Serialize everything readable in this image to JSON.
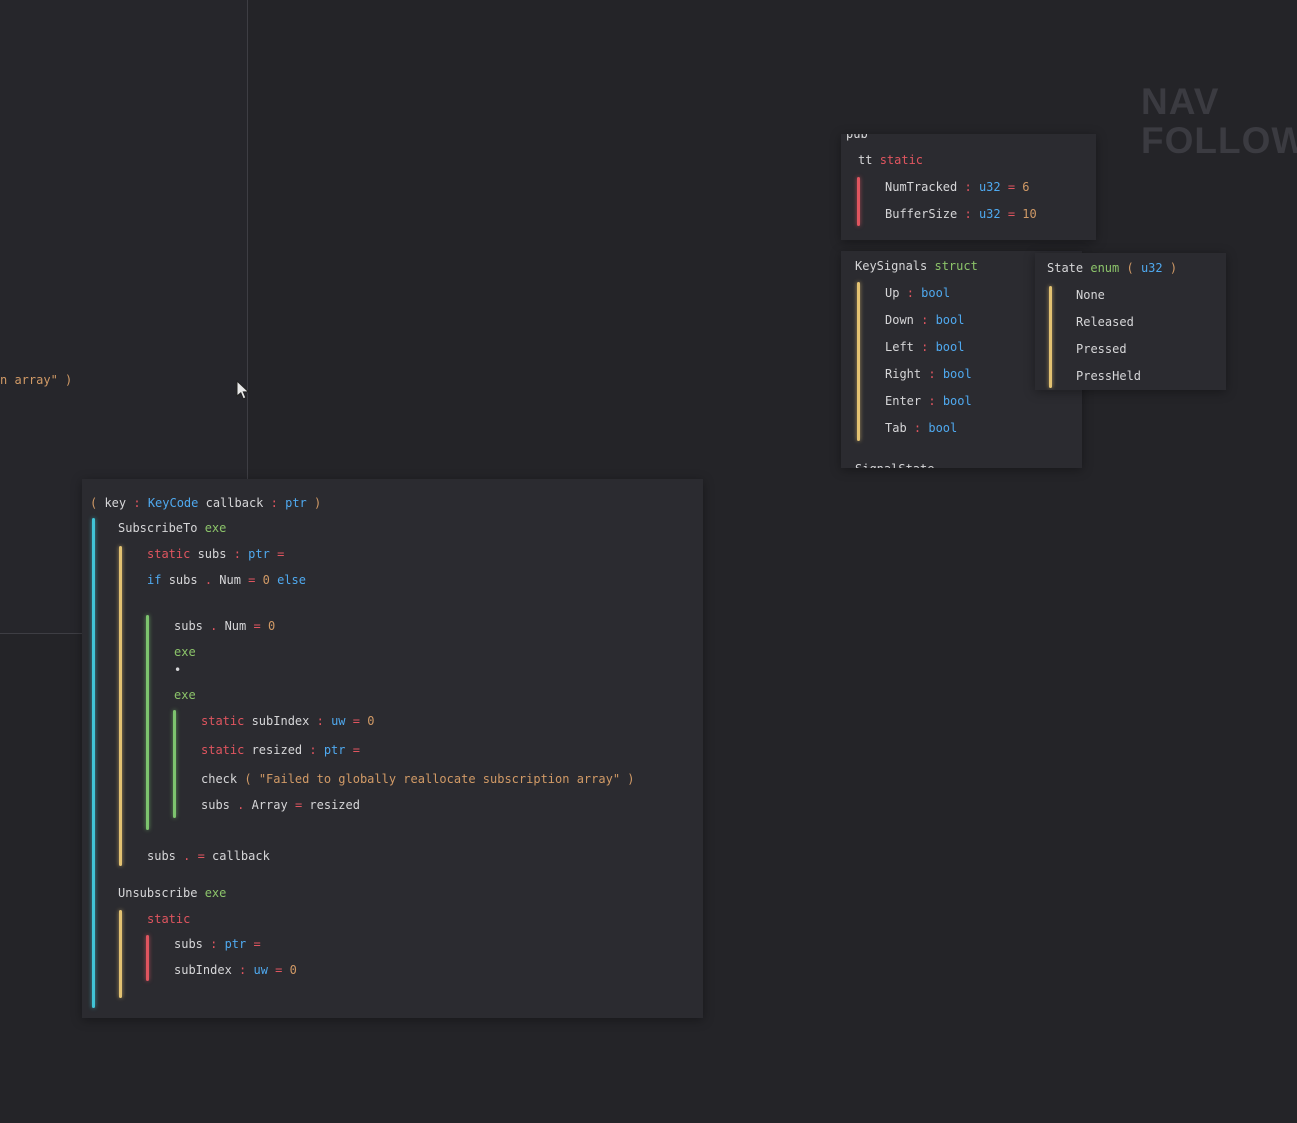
{
  "colors": {
    "background": "#242428",
    "panel": "#2b2b30",
    "text": "#d6d6d8",
    "keyword_red": "#e0555f",
    "keyword_green": "#8cc46a",
    "type_blue": "#4fa9ef",
    "literal_orange": "#d19a66",
    "bar_cyan": "#41c4d6",
    "bar_yellow": "#e3c272",
    "bar_green": "#7dc46e",
    "bar_red": "#e0555f",
    "watermark": "#3b3b41"
  },
  "watermark": {
    "line1": "NAV",
    "line2": "FOLLOW"
  },
  "left_fragment": {
    "tokens": [
      {
        "t": "n array\" ",
        "c": "o"
      },
      {
        "t": ")",
        "c": "o"
      }
    ]
  },
  "tracking_panel": {
    "clipped_top": {
      "tokens": [
        {
          "t": "pub",
          "c": "w"
        }
      ]
    },
    "header": {
      "tokens": [
        {
          "t": "tt ",
          "c": "w"
        },
        {
          "t": "static",
          "c": "r"
        }
      ]
    },
    "lines": [
      {
        "tokens": [
          {
            "t": "NumTracked ",
            "c": "w"
          },
          {
            "t": ": ",
            "c": "r"
          },
          {
            "t": "u32 ",
            "c": "b"
          },
          {
            "t": "= ",
            "c": "r"
          },
          {
            "t": "6",
            "c": "o"
          }
        ]
      },
      {
        "tokens": [
          {
            "t": "BufferSize ",
            "c": "w"
          },
          {
            "t": ": ",
            "c": "r"
          },
          {
            "t": "u32 ",
            "c": "b"
          },
          {
            "t": "= ",
            "c": "r"
          },
          {
            "t": "10",
            "c": "o"
          }
        ]
      }
    ]
  },
  "keysignals_panel": {
    "header": {
      "tokens": [
        {
          "t": "KeySignals ",
          "c": "w"
        },
        {
          "t": "struct",
          "c": "g"
        }
      ]
    },
    "fields": [
      {
        "tokens": [
          {
            "t": "Up ",
            "c": "w"
          },
          {
            "t": ": ",
            "c": "r"
          },
          {
            "t": "bool",
            "c": "b"
          }
        ]
      },
      {
        "tokens": [
          {
            "t": "Down ",
            "c": "w"
          },
          {
            "t": ": ",
            "c": "r"
          },
          {
            "t": "bool",
            "c": "b"
          }
        ]
      },
      {
        "tokens": [
          {
            "t": "Left ",
            "c": "w"
          },
          {
            "t": ": ",
            "c": "r"
          },
          {
            "t": "bool",
            "c": "b"
          }
        ]
      },
      {
        "tokens": [
          {
            "t": "Right ",
            "c": "w"
          },
          {
            "t": ": ",
            "c": "r"
          },
          {
            "t": "bool",
            "c": "b"
          }
        ]
      },
      {
        "tokens": [
          {
            "t": "Enter ",
            "c": "w"
          },
          {
            "t": ": ",
            "c": "r"
          },
          {
            "t": "bool",
            "c": "b"
          }
        ]
      },
      {
        "tokens": [
          {
            "t": "Tab ",
            "c": "w"
          },
          {
            "t": ": ",
            "c": "r"
          },
          {
            "t": "bool",
            "c": "b"
          }
        ]
      }
    ],
    "clipped_bottom": {
      "tokens": [
        {
          "t": "SignalState",
          "c": "w"
        }
      ]
    }
  },
  "state_panel": {
    "header": {
      "tokens": [
        {
          "t": "State ",
          "c": "w"
        },
        {
          "t": "enum ",
          "c": "g"
        },
        {
          "t": "( ",
          "c": "o"
        },
        {
          "t": "u32 ",
          "c": "b"
        },
        {
          "t": ")",
          "c": "o"
        }
      ]
    },
    "values": [
      {
        "tokens": [
          {
            "t": "None",
            "c": "w"
          }
        ]
      },
      {
        "tokens": [
          {
            "t": "Released",
            "c": "w"
          }
        ]
      },
      {
        "tokens": [
          {
            "t": "Pressed",
            "c": "w"
          }
        ]
      },
      {
        "tokens": [
          {
            "t": "PressHeld",
            "c": "w"
          }
        ]
      }
    ]
  },
  "main_panel": {
    "lines": [
      {
        "tokens": [
          {
            "t": "( ",
            "c": "o"
          },
          {
            "t": "key ",
            "c": "w"
          },
          {
            "t": ": ",
            "c": "r"
          },
          {
            "t": "KeyCode ",
            "c": "b"
          },
          {
            "t": "callback ",
            "c": "w"
          },
          {
            "t": ": ",
            "c": "r"
          },
          {
            "t": "ptr ",
            "c": "b"
          },
          {
            "t": ")",
            "c": "o"
          }
        ]
      },
      {
        "tokens": [
          {
            "t": "SubscribeTo ",
            "c": "w"
          },
          {
            "t": "exe",
            "c": "g"
          }
        ]
      },
      {
        "tokens": [
          {
            "t": "static ",
            "c": "r"
          },
          {
            "t": "subs ",
            "c": "w"
          },
          {
            "t": ": ",
            "c": "r"
          },
          {
            "t": "ptr ",
            "c": "b"
          },
          {
            "t": "=",
            "c": "r"
          }
        ]
      },
      {
        "tokens": [
          {
            "t": "if ",
            "c": "b"
          },
          {
            "t": "subs ",
            "c": "w"
          },
          {
            "t": ". ",
            "c": "r"
          },
          {
            "t": "Num ",
            "c": "w"
          },
          {
            "t": "= ",
            "c": "r"
          },
          {
            "t": "0 ",
            "c": "o"
          },
          {
            "t": "else",
            "c": "b"
          }
        ]
      },
      {
        "tokens": [
          {
            "t": "subs ",
            "c": "w"
          },
          {
            "t": ". ",
            "c": "r"
          },
          {
            "t": "Num ",
            "c": "w"
          },
          {
            "t": "= ",
            "c": "r"
          },
          {
            "t": "0",
            "c": "o"
          }
        ]
      },
      {
        "tokens": [
          {
            "t": "exe",
            "c": "g"
          }
        ]
      },
      {
        "tokens": [
          {
            "t": "•",
            "c": "w"
          }
        ]
      },
      {
        "tokens": [
          {
            "t": "exe",
            "c": "g"
          }
        ]
      },
      {
        "tokens": [
          {
            "t": "static ",
            "c": "r"
          },
          {
            "t": "subIndex ",
            "c": "w"
          },
          {
            "t": ": ",
            "c": "r"
          },
          {
            "t": "uw ",
            "c": "b"
          },
          {
            "t": "= ",
            "c": "r"
          },
          {
            "t": "0",
            "c": "o"
          }
        ]
      },
      {
        "tokens": [
          {
            "t": "static ",
            "c": "r"
          },
          {
            "t": "resized ",
            "c": "w"
          },
          {
            "t": ": ",
            "c": "r"
          },
          {
            "t": "ptr ",
            "c": "b"
          },
          {
            "t": "=",
            "c": "r"
          }
        ]
      },
      {
        "tokens": [
          {
            "t": "check ",
            "c": "w"
          },
          {
            "t": "( ",
            "c": "o"
          },
          {
            "t": "\"Failed to globally reallocate subscription array\" ",
            "c": "o"
          },
          {
            "t": ")",
            "c": "o"
          }
        ]
      },
      {
        "tokens": [
          {
            "t": "subs ",
            "c": "w"
          },
          {
            "t": ". ",
            "c": "r"
          },
          {
            "t": "Array ",
            "c": "w"
          },
          {
            "t": "= ",
            "c": "r"
          },
          {
            "t": "resized",
            "c": "w"
          }
        ]
      },
      {
        "tokens": [
          {
            "t": "subs ",
            "c": "w"
          },
          {
            "t": ". ",
            "c": "r"
          },
          {
            "t": "= ",
            "c": "r"
          },
          {
            "t": "callback",
            "c": "w"
          }
        ]
      },
      {
        "tokens": [
          {
            "t": "Unsubscribe ",
            "c": "w"
          },
          {
            "t": "exe",
            "c": "g"
          }
        ]
      },
      {
        "tokens": [
          {
            "t": "static",
            "c": "r"
          }
        ]
      },
      {
        "tokens": [
          {
            "t": "subs ",
            "c": "w"
          },
          {
            "t": ": ",
            "c": "r"
          },
          {
            "t": "ptr ",
            "c": "b"
          },
          {
            "t": "=",
            "c": "r"
          }
        ]
      },
      {
        "tokens": [
          {
            "t": "subIndex ",
            "c": "w"
          },
          {
            "t": ": ",
            "c": "r"
          },
          {
            "t": "uw ",
            "c": "b"
          },
          {
            "t": "= ",
            "c": "r"
          },
          {
            "t": "0",
            "c": "o"
          }
        ]
      }
    ]
  }
}
